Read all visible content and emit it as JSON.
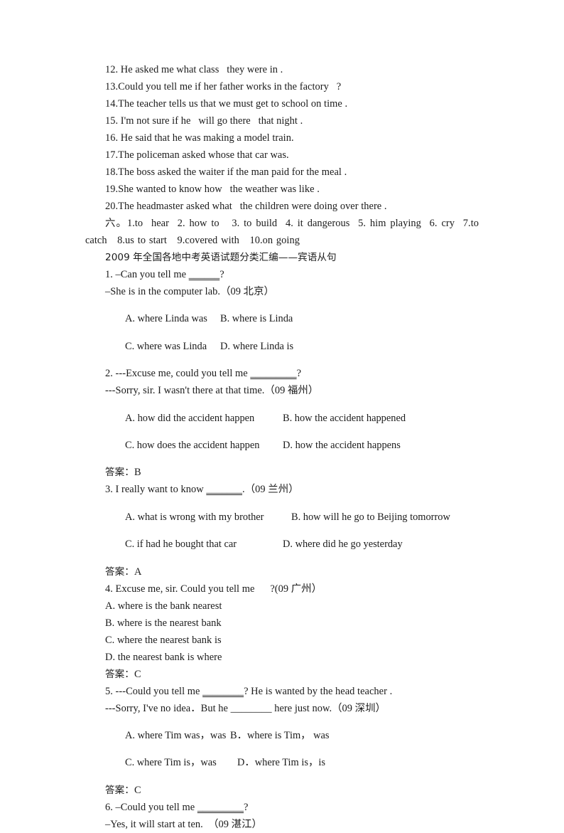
{
  "document": {
    "rewrite_section": {
      "lines": [
        "12. He asked me what class   they were in .",
        "13.Could you tell me if her father works in the factory   ?",
        "14.The teacher tells us that we must get to school on time .",
        "15. I'm not sure if he   will go there   that night .",
        "16. He said that he was making a model train.",
        "17.The policeman asked whose that car was.",
        "18.The boss asked the waiter if the man paid for the meal .",
        "19.She wanted to know how   the weather was like .",
        "20.The headmaster asked what   the children were doing over there ."
      ]
    },
    "answer_key_six": "六。1.to  hear  2. how to   3. to build  4. it dangerous  5. him playing  6. cry  7.to catch   8.us to start   9.covered with   10.on going",
    "title": "2009 年全国各地中考英语试题分类汇编——宾语从句",
    "questions": [
      {
        "stem": "1. –Can you tell me ",
        "blank": "______",
        "stem_tail": "?",
        "dialogue": "–She is in the computer lab.（09 北京）",
        "option_layout": "two-column",
        "col_gap": 66,
        "options": [
          "A. where Linda was",
          "B. where is Linda",
          "C. where was Linda",
          "D. where Linda is"
        ],
        "answer_label": "",
        "answer_value": ""
      },
      {
        "stem": "2. ---Excuse me, could you tell me ",
        "blank": "_________",
        "stem_tail": "?",
        "dialogue": "---Sorry, sir. I wasn't there at that time.（09 福州）",
        "option_layout": "two-column",
        "col_gap": 152,
        "options": [
          "A. how did the accident happen",
          "B. how the accident happened",
          "C. how does the accident happen",
          "D. how the accident happens"
        ],
        "answer_label": "答案：",
        "answer_value": "B"
      },
      {
        "stem": "3. I really want to know ",
        "blank": "_______",
        "stem_tail": ".（09 兰州）",
        "dialogue": "",
        "option_layout": "two-column",
        "col_gap": 162,
        "options": [
          "A. what is wrong with my brother",
          "B. how will he go to Beijing tomorrow",
          "C. if had he bought that car",
          "D. where did he go yesterday"
        ],
        "answer_label": "答案：",
        "answer_value": "A"
      },
      {
        "stem": "4. Excuse me, sir. Could you tell me      ?(09 广州）",
        "blank": "",
        "stem_tail": "",
        "dialogue": "",
        "option_layout": "stacked",
        "col_gap": 0,
        "options": [
          "A. where is the bank nearest",
          "B. where is the nearest bank",
          "C. where the nearest bank is",
          "D. the nearest bank is where"
        ],
        "answer_label": "答案：",
        "answer_value": "C"
      },
      {
        "stem": "5. ---Could you tell me ",
        "blank": "________",
        "stem_tail": "? He is wanted by the head teacher .",
        "dialogue": "---Sorry, I've no idea．But he ________ here just now.（09 深圳）",
        "option_layout": "two-column",
        "col_gap": 70,
        "options": [
          "A. where Tim was，was",
          "B．where is Tim， was",
          "C. where Tim is，was",
          "D．where Tim is，is"
        ],
        "answer_label": "答案：",
        "answer_value": "C"
      },
      {
        "stem": "6. –Could you tell me ",
        "blank": "_________",
        "stem_tail": "?",
        "dialogue": "–Yes, it will start at ten.  （09 湛江）",
        "option_layout": "none",
        "col_gap": 0,
        "options": [],
        "answer_label": "",
        "answer_value": ""
      }
    ]
  }
}
